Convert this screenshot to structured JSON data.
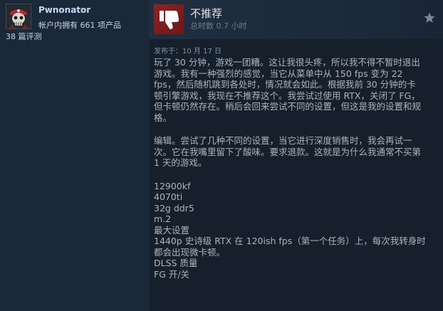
{
  "author": {
    "name": "Pwnonator",
    "products_owned": "帐户内拥有 661 项产品",
    "review_count": "38 篇评测",
    "avatar_icon": "pirate-skull-avatar"
  },
  "review": {
    "verdict": "不推荐",
    "verdict_icon": "thumbs-down-icon",
    "verdict_color": "#8e2222",
    "playtime": "总时数 0.7 小时",
    "award_icon": "star-icon",
    "posted": "发布于：10 月 17 日",
    "paragraph1": [
      "玩了 30 分钟，游戏一团糟。这让我很头疼，所以我不得不暂时退出",
      "游戏。我有一种强烈的感觉，当它从菜单中从 150 fps 变为 22",
      "fps，然后随机跳到各处时，情况就会如此。根据我前 30 分钟的卡",
      "顿引擎游戏，我现在不推荐这个。我尝试过使用 RTX，关闭了 FG，",
      "但卡顿仍然存在。稍后会回来尝试不同的设置，但这是我的设置和规",
      "格。"
    ],
    "paragraph2": [
      "编辑。尝试了几种不同的设置，当它进行深度销售时，我会再试一",
      "次。它在我嘴里留下了酸味。要求退款。这就是为什么我通常不买第",
      "1 天的游戏。"
    ],
    "specs": [
      "12900kf",
      "4070ti",
      "32g ddr5",
      "m.2",
      "最大设置",
      "1440p 史诗级 RTX 在 120ish fps（第一个任务）上，每次我转身时",
      "都会出现微卡顿。",
      "DLSS 质量",
      "FG 开/关"
    ]
  }
}
